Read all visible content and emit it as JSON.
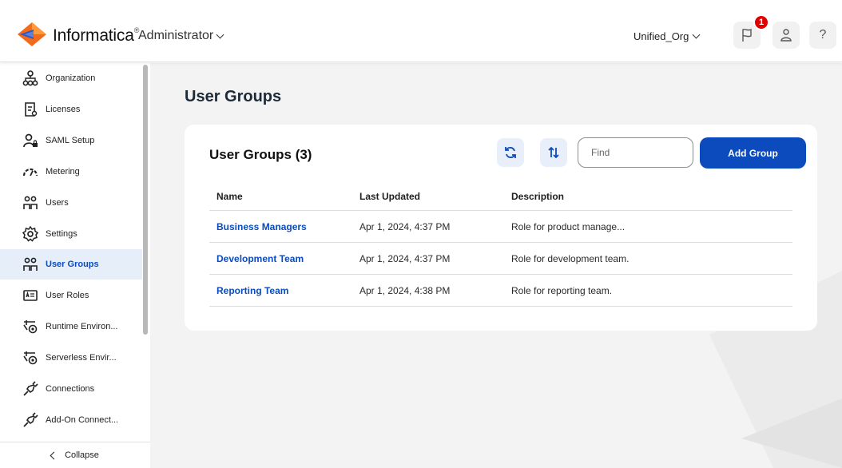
{
  "header": {
    "brand": "Informatica",
    "brand_mark": "®",
    "app": "Administrator",
    "org": "Unified_Org",
    "notification_count": "1"
  },
  "sidebar": {
    "items": [
      {
        "label": "Organization",
        "icon": "organization-icon"
      },
      {
        "label": "Licenses",
        "icon": "license-icon"
      },
      {
        "label": "SAML Setup",
        "icon": "saml-setup-icon"
      },
      {
        "label": "Metering",
        "icon": "metering-gauge-icon"
      },
      {
        "label": "Users",
        "icon": "users-icon"
      },
      {
        "label": "Settings",
        "icon": "settings-gear-icon"
      },
      {
        "label": "User Groups",
        "icon": "user-groups-icon",
        "active": true
      },
      {
        "label": "User Roles",
        "icon": "user-roles-icon"
      },
      {
        "label": "Runtime Environ...",
        "icon": "runtime-environment-icon"
      },
      {
        "label": "Serverless Envir...",
        "icon": "serverless-environment-icon"
      },
      {
        "label": "Connections",
        "icon": "connections-plug-icon"
      },
      {
        "label": "Add-On Connect...",
        "icon": "addon-connector-plug-icon"
      }
    ],
    "collapse_label": "Collapse"
  },
  "main": {
    "page_title": "User Groups",
    "card_title": "User Groups (3)",
    "find_placeholder": "Find",
    "add_button": "Add Group",
    "columns": [
      "Name",
      "Last Updated",
      "Description"
    ],
    "rows": [
      {
        "name": "Business Managers",
        "updated": "Apr 1, 2024, 4:37 PM",
        "description": "Role for product manage..."
      },
      {
        "name": "Development Team",
        "updated": "Apr 1, 2024, 4:37 PM",
        "description": "Role for development team."
      },
      {
        "name": "Reporting Team",
        "updated": "Apr 1, 2024, 4:38 PM",
        "description": "Role for reporting team."
      }
    ]
  },
  "colors": {
    "primary": "#0b4bbd",
    "active_bg": "#e6eefa",
    "badge": "#e00000",
    "logo_orange": "#f26b1d",
    "logo_blue": "#2558c9"
  }
}
